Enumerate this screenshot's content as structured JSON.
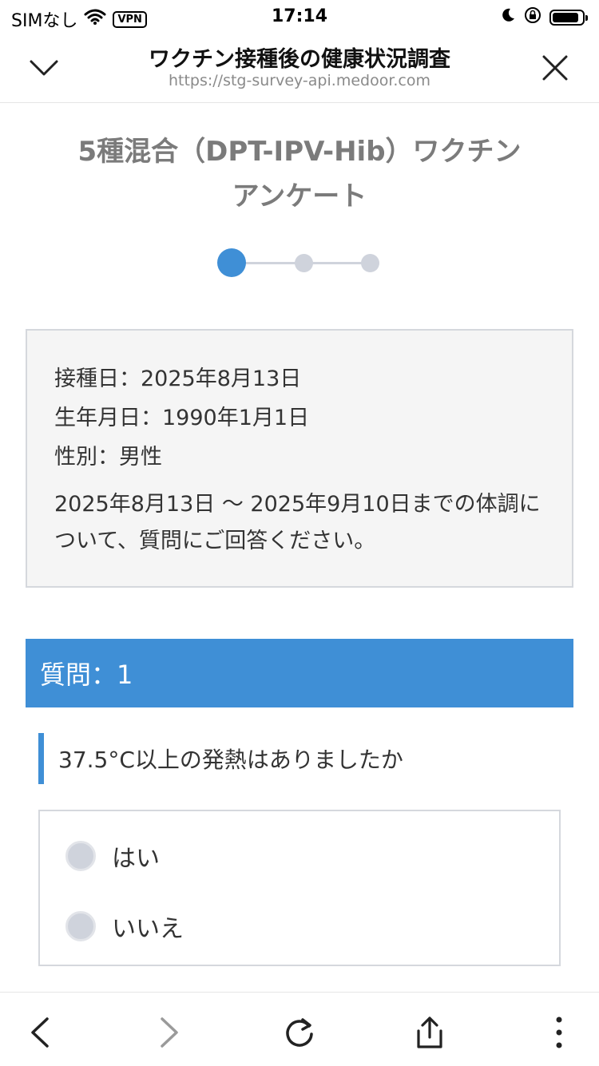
{
  "status_bar": {
    "carrier": "SIMなし",
    "vpn": "VPN",
    "time": "17:14"
  },
  "browser": {
    "title": "ワクチン接種後の健康状況調査",
    "url": "https://stg-survey-api.medoor.com"
  },
  "survey": {
    "title_line1": "5種混合（DPT-IPV-Hib）ワクチン",
    "title_line2": "アンケート",
    "steps_total": 3,
    "current_step": 1
  },
  "info": {
    "vaccination_date": "接種日：2025年8月13日",
    "birth_date": "生年月日：1990年1月1日",
    "sex": "性別：男性",
    "description": "2025年8月13日 〜 2025年9月10日までの体調について、質問にご回答ください。"
  },
  "question": {
    "header": "質問：1",
    "text": "37.5°C以上の発熱はありましたか",
    "options": [
      "はい",
      "いいえ"
    ]
  },
  "colors": {
    "accent": "#3f8fd6",
    "inactive": "#cfd3dc",
    "title_gray": "#7b7b7b"
  }
}
